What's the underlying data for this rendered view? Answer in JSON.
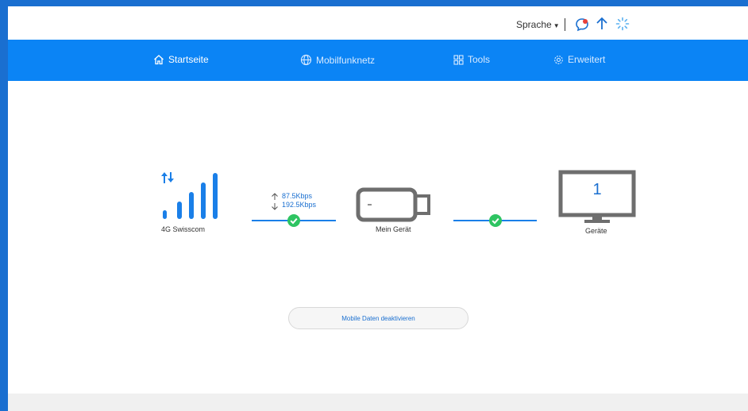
{
  "header": {
    "language_label": "Sprache",
    "icons": [
      "chat-bubble-icon",
      "upload-arrow-icon",
      "loading-spinner-icon"
    ]
  },
  "nav": {
    "items": [
      {
        "label": "Startseite",
        "icon": "home-icon",
        "active": true
      },
      {
        "label": "Mobilfunknetz",
        "icon": "globe-icon",
        "active": false
      },
      {
        "label": "Tools",
        "icon": "tools-grid-icon",
        "active": false
      },
      {
        "label": "Erweitert",
        "icon": "gear-icon",
        "active": false
      }
    ]
  },
  "status": {
    "network_label": "4G  Swisscom",
    "upload_speed": "87.5Kbps",
    "download_speed": "192.5Kbps",
    "device_label": "Mein Gerät",
    "connected_count": "1",
    "connected_label": "Geräte"
  },
  "actions": {
    "mobile_data_button": "Mobile Daten deaktivieren"
  },
  "colors": {
    "accent": "#0b84f5",
    "check": "#2ec462",
    "device_gray": "#6e6e6e"
  }
}
